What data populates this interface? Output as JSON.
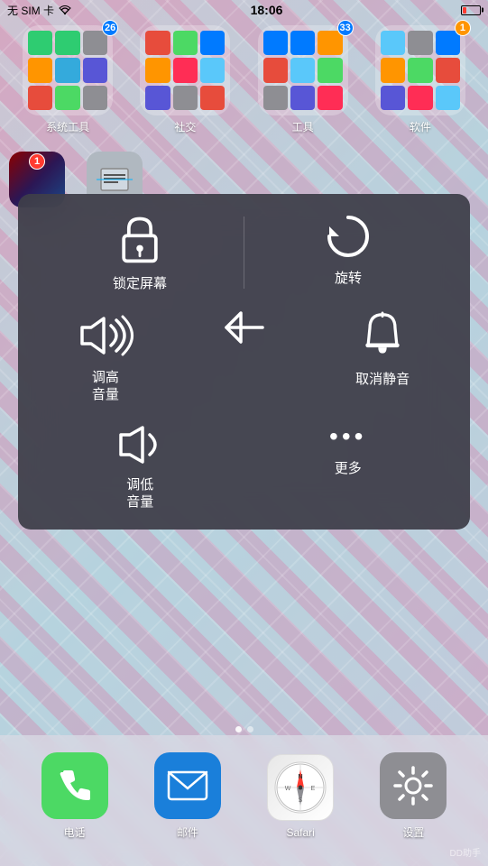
{
  "statusBar": {
    "carrier": "无 SIM 卡",
    "wifi": "WiFi",
    "time": "18:06"
  },
  "folders": [
    {
      "label": "系统工具",
      "badge": "26",
      "badgeColor": "blue"
    },
    {
      "label": "社交",
      "badge": null
    },
    {
      "label": "工具",
      "badge": "33",
      "badgeColor": "blue"
    },
    {
      "label": "软件",
      "badge": "1",
      "badgeColor": "orange"
    }
  ],
  "popup": {
    "row1": [
      {
        "icon": "lock",
        "label": "锁定屏幕"
      },
      {
        "icon": "rotate",
        "label": "旋转"
      }
    ],
    "row2": [
      {
        "icon": "volume-up",
        "label": "调高\n音量"
      },
      {
        "icon": "back-arrow",
        "label": ""
      },
      {
        "icon": "bell",
        "label": "取消静音"
      }
    ],
    "row3": [
      {
        "icon": "volume-down",
        "label": "调低\n音量"
      },
      {
        "icon": "dots",
        "label": "更多"
      }
    ]
  },
  "pageDots": [
    "active",
    "inactive"
  ],
  "dock": [
    {
      "label": "电话",
      "icon": "phone"
    },
    {
      "label": "邮件",
      "icon": "mail"
    },
    {
      "label": "Safari",
      "icon": "safari"
    },
    {
      "label": "设置",
      "icon": "settings"
    }
  ],
  "watermark": "DD助手"
}
